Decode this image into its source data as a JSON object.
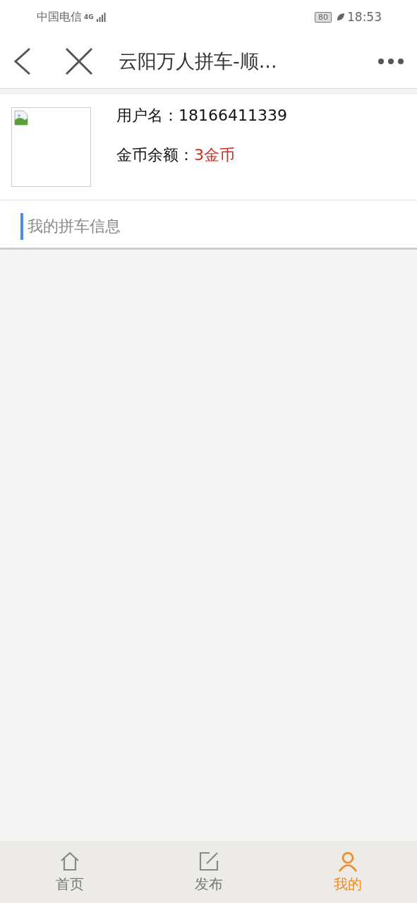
{
  "status_bar": {
    "carrier": "中国电信",
    "network": "4G",
    "battery": "80",
    "time": "18:53"
  },
  "nav": {
    "title": "云阳万人拼车-顺..."
  },
  "profile": {
    "username_label": "用户名：",
    "username": "18166411339",
    "balance_label": "金币余额：",
    "balance": "3金币"
  },
  "section": {
    "title": "我的拼车信息"
  },
  "tabs": [
    {
      "kind": "home",
      "label": "首页",
      "selected": false
    },
    {
      "kind": "edit",
      "label": "发布",
      "selected": false
    },
    {
      "kind": "user",
      "label": "我的",
      "selected": true
    }
  ]
}
